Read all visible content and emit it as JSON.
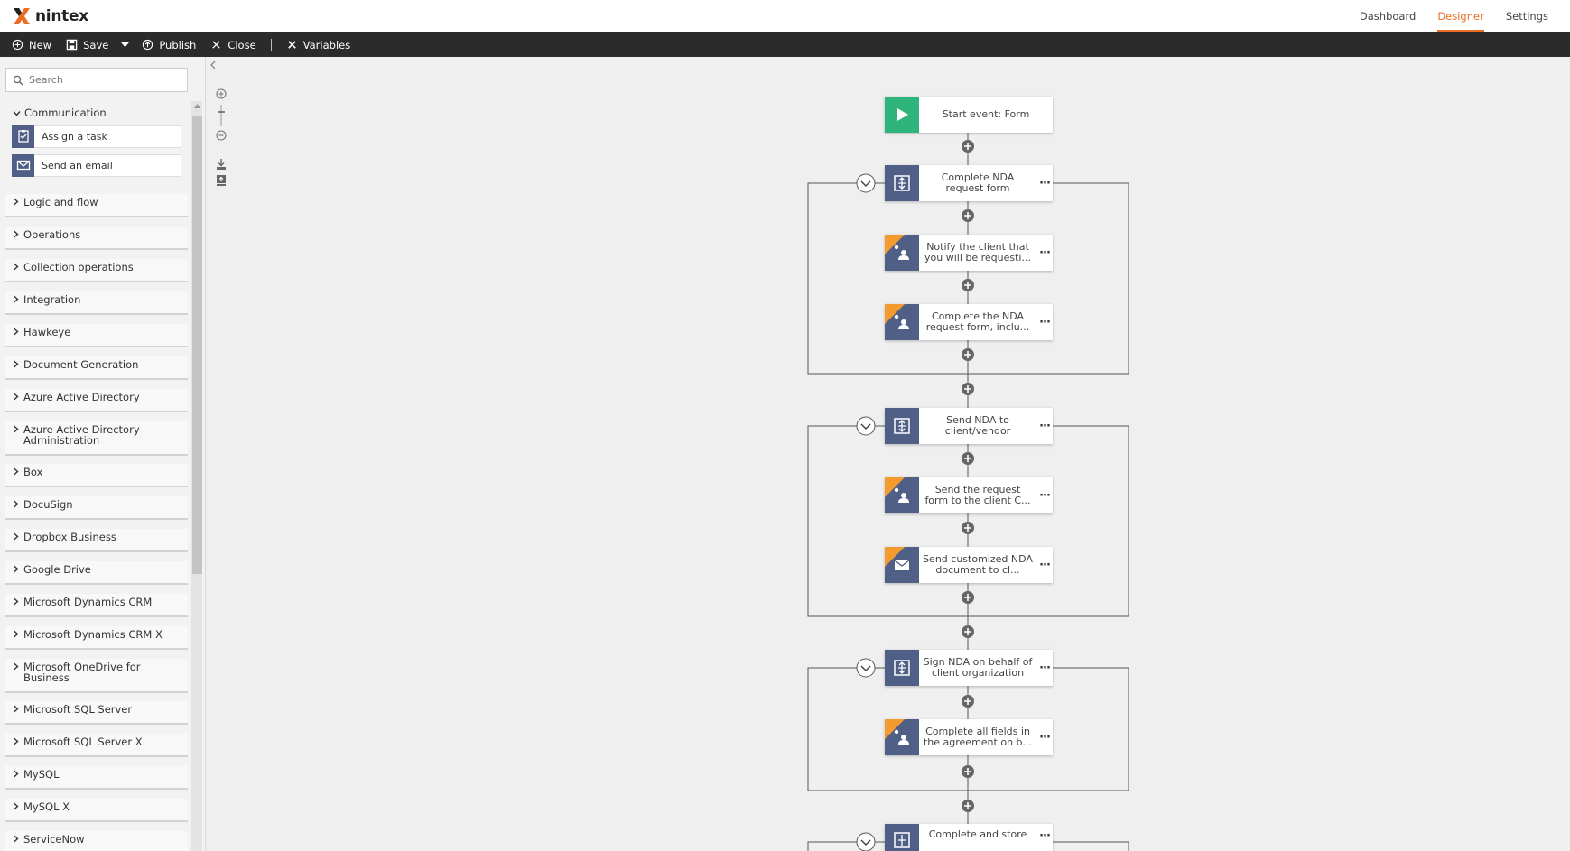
{
  "app": {
    "logo_text": "nintex",
    "brand_color": "#ea6d21"
  },
  "topnav": [
    {
      "label": "Dashboard",
      "active": false
    },
    {
      "label": "Designer",
      "active": true
    },
    {
      "label": "Settings",
      "active": false
    }
  ],
  "toolbar": {
    "new_label": "New",
    "save_label": "Save",
    "publish_label": "Publish",
    "close_label": "Close",
    "variables_label": "Variables"
  },
  "sidebar": {
    "search_placeholder": "Search",
    "communication": {
      "label": "Communication",
      "actions": [
        "Assign a task",
        "Send an email"
      ]
    },
    "categories": [
      "Logic and flow",
      "Operations",
      "Collection operations",
      "Integration",
      "Hawkeye",
      "Document Generation",
      "Azure Active Directory",
      "Azure Active Directory Administration",
      "Box",
      "DocuSign",
      "Dropbox Business",
      "Google Drive",
      "Microsoft Dynamics CRM",
      "Microsoft Dynamics CRM X",
      "Microsoft OneDrive for Business",
      "Microsoft SQL Server",
      "Microsoft SQL Server X",
      "MySQL",
      "MySQL X",
      "ServiceNow"
    ]
  },
  "workflow": {
    "start": "Start event: Form",
    "branch1": {
      "title": "Complete NDA request form",
      "step1": "Notify the client that you will be requesti...",
      "step2": "Complete the NDA request form, inclu..."
    },
    "branch2": {
      "title": "Send NDA to client/vendor",
      "step1": "Send the request form to the client C...",
      "step2": "Send customized NDA document to cl..."
    },
    "branch3": {
      "title": "Sign NDA on behalf of client organization",
      "step1": "Complete all fields in the agreement on b..."
    },
    "branch4": {
      "title": "Complete and store"
    }
  }
}
